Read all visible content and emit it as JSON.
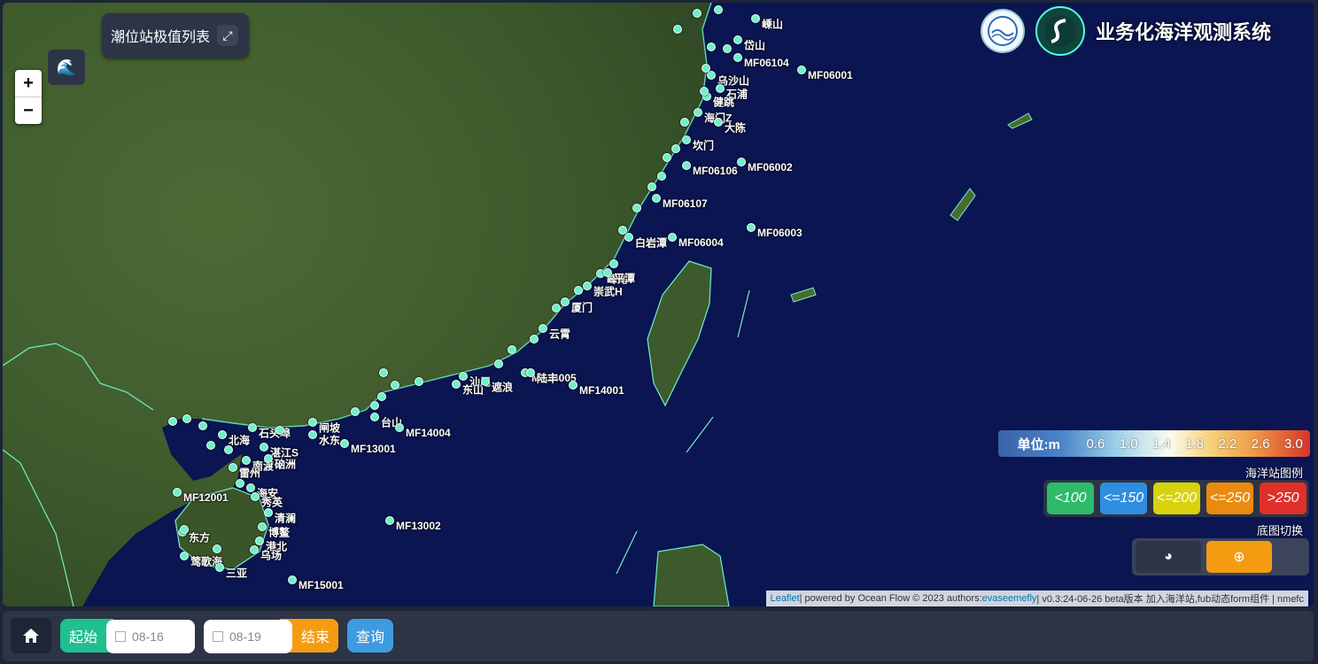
{
  "panel": {
    "title": "潮位站极值列表"
  },
  "zoom": {
    "in": "+",
    "out": "−"
  },
  "header": {
    "system_title": "业务化海洋观测系统"
  },
  "scale": {
    "unit": "单位:m",
    "ticks": [
      "0.6",
      "1.0",
      "1.4",
      "1.8",
      "2.2",
      "2.6",
      "3.0"
    ]
  },
  "legend": {
    "title": "海洋站图例",
    "items": [
      {
        "label": "<100",
        "color": "#2dba6a"
      },
      {
        "label": "<=150",
        "color": "#2f8ee0"
      },
      {
        "label": "<=200",
        "color": "#d8d20e"
      },
      {
        "label": "<=250",
        "color": "#ea8a10"
      },
      {
        "label": ">250",
        "color": "#e0302a"
      }
    ]
  },
  "basemap": {
    "title": "底图切换"
  },
  "attribution": {
    "link": "Leaflet",
    "text1": " | powered by Ocean Flow © 2023 authors: ",
    "author": "evaseemefly",
    "text2": " | v0.3:24-06-26 beta版本 加入海洋站,fub动态form组件 | nmefc"
  },
  "bottom": {
    "start_label": "起始",
    "start_date": "08-16",
    "end_date": "08-19",
    "end_label": "结束",
    "query_label": "查询"
  },
  "stations": [
    {
      "name": "嵊山"
    },
    {
      "name": "岱山"
    },
    {
      "name": "MF06104"
    },
    {
      "name": "MF06001"
    },
    {
      "name": "乌沙山"
    },
    {
      "name": "石浦"
    },
    {
      "name": "健跳"
    },
    {
      "name": "海门Z"
    },
    {
      "name": "大陈"
    },
    {
      "name": "坎门"
    },
    {
      "name": "MF06106"
    },
    {
      "name": "MF06002"
    },
    {
      "name": "MF06107"
    },
    {
      "name": "MF06004"
    },
    {
      "name": "MF06003"
    },
    {
      "name": "白岩潭"
    },
    {
      "name": "峰尾"
    },
    {
      "name": "崇武H"
    },
    {
      "name": "厦门"
    },
    {
      "name": "云霄"
    },
    {
      "name": "MF14005"
    },
    {
      "name": "MF14001"
    },
    {
      "name": "汕尾"
    },
    {
      "name": "遮浪"
    },
    {
      "name": "台山"
    },
    {
      "name": "MF14004"
    },
    {
      "name": "闸坡"
    },
    {
      "name": "水东"
    },
    {
      "name": "MF13001"
    },
    {
      "name": "石头埠"
    },
    {
      "name": "北海"
    },
    {
      "name": "湛江S"
    },
    {
      "name": "南渡"
    },
    {
      "name": "硇洲"
    },
    {
      "name": "雷州"
    },
    {
      "name": "海安"
    },
    {
      "name": "秀英"
    },
    {
      "name": "MF12001"
    },
    {
      "name": "清澜"
    },
    {
      "name": "东方"
    },
    {
      "name": "博鳌"
    },
    {
      "name": "港北"
    },
    {
      "name": "乌场"
    },
    {
      "name": "莺歌海"
    },
    {
      "name": "三亚"
    },
    {
      "name": "MF13002"
    },
    {
      "name": "MF15001"
    },
    {
      "name": "陆丰"
    },
    {
      "name": "东山"
    },
    {
      "name": "平潭"
    }
  ]
}
